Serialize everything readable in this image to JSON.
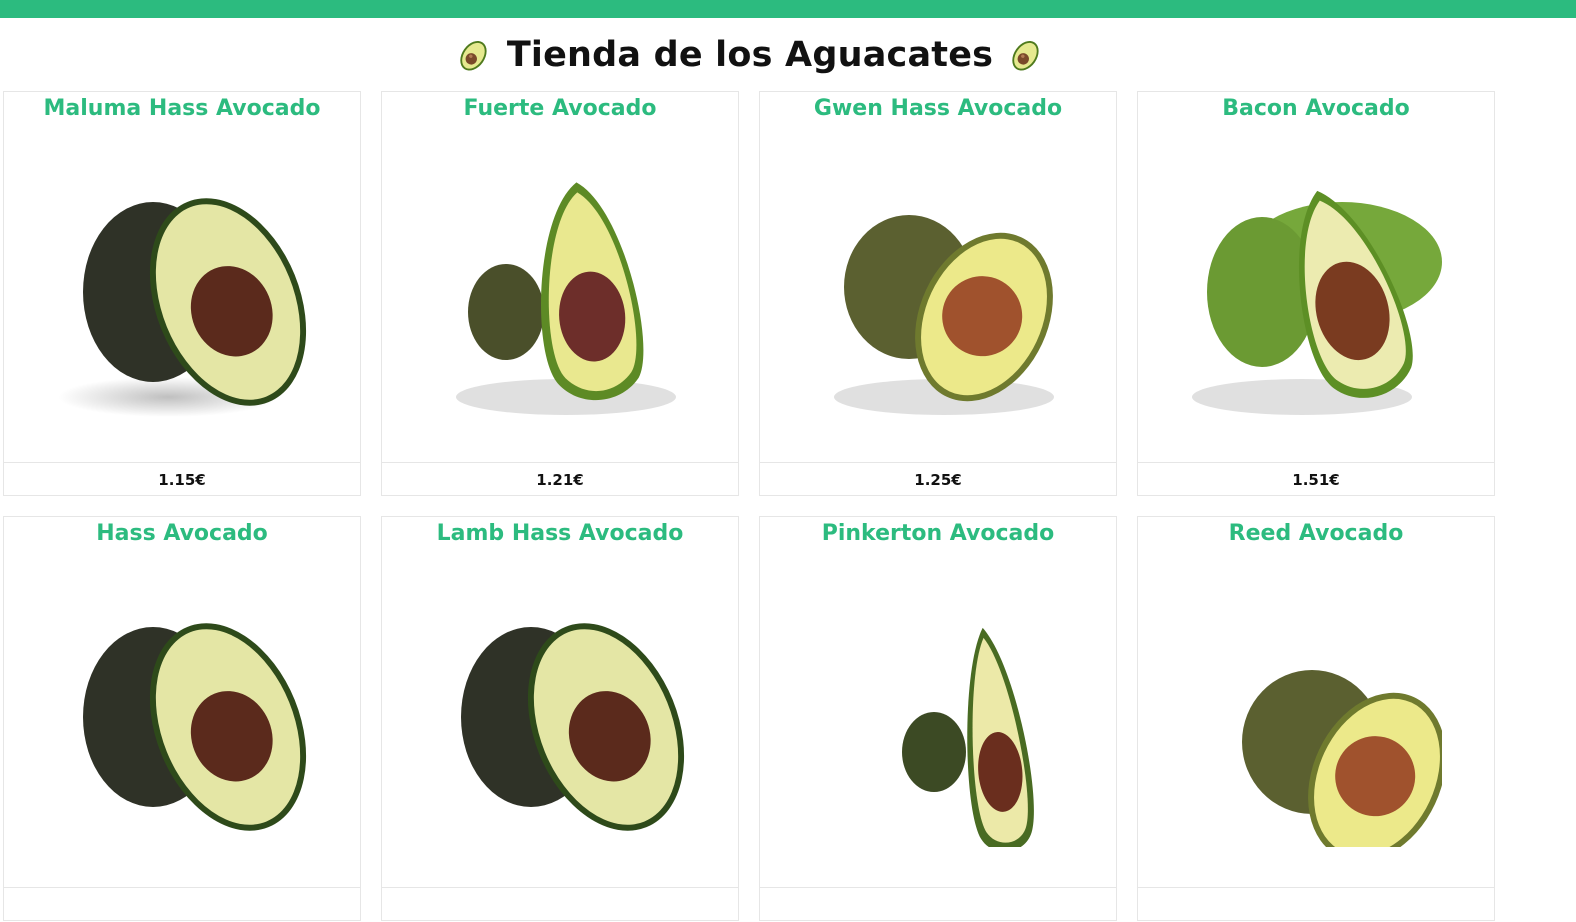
{
  "header": {
    "title": "Tienda de los Aguacates",
    "icon": "avocado-emoji",
    "bar_color": "#2cbb7f"
  },
  "colors": {
    "accent": "#2cbb7f",
    "card_border": "#e6e6e6"
  },
  "products": [
    {
      "name": "Maluma Hass Avocado",
      "price": "1.15€",
      "variety": "hass-dark"
    },
    {
      "name": "Fuerte Avocado",
      "price": "1.21€",
      "variety": "fuerte"
    },
    {
      "name": "Gwen Hass Avocado",
      "price": "1.25€",
      "variety": "gwen"
    },
    {
      "name": "Bacon Avocado",
      "price": "1.51€",
      "variety": "bacon"
    },
    {
      "name": "Hass Avocado",
      "price": "",
      "variety": "hass-dark"
    },
    {
      "name": "Lamb Hass Avocado",
      "price": "",
      "variety": "hass-dark"
    },
    {
      "name": "Pinkerton Avocado",
      "price": "",
      "variety": "pinkerton"
    },
    {
      "name": "Reed Avocado",
      "price": "",
      "variety": "gwen"
    }
  ]
}
